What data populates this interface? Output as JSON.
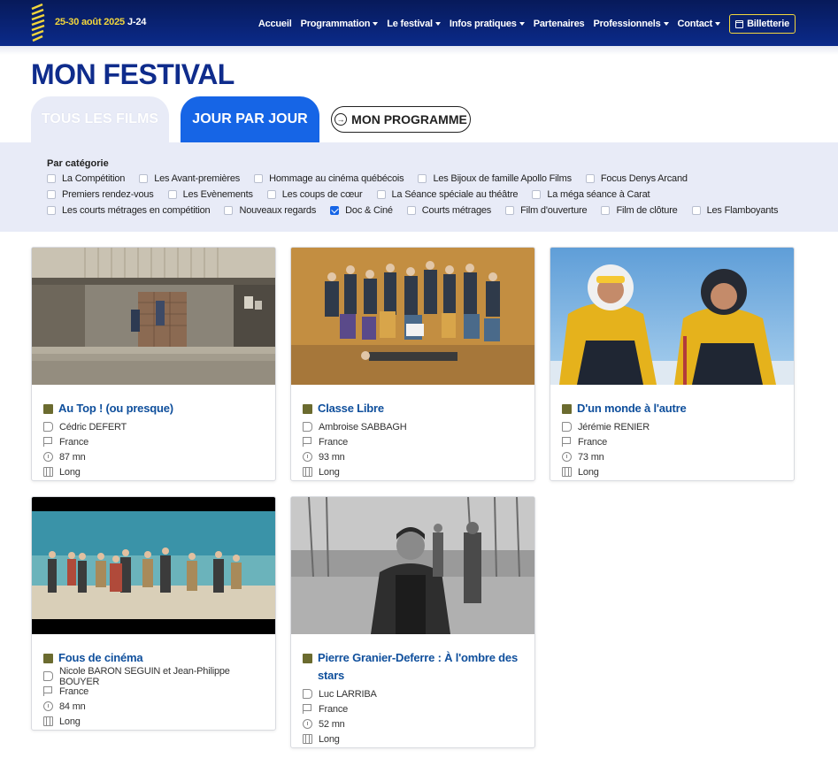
{
  "header": {
    "dates": "25-30 août 2025",
    "countdown": "J-24",
    "nav": [
      {
        "label": "Accueil",
        "dropdown": false
      },
      {
        "label": "Programmation",
        "dropdown": true
      },
      {
        "label": "Le festival",
        "dropdown": true
      },
      {
        "label": "Infos pratiques",
        "dropdown": true
      },
      {
        "label": "Partenaires",
        "dropdown": false
      },
      {
        "label": "Professionnels",
        "dropdown": true
      },
      {
        "label": "Contact",
        "dropdown": true
      }
    ],
    "ticket_label": "Billetterie"
  },
  "page_title": "MON FESTIVAL",
  "tabs": {
    "all": "TOUS LES FILMS",
    "day": "JOUR PAR JOUR",
    "program": "MON PROGRAMME"
  },
  "filters": {
    "title": "Par catégorie",
    "rows": [
      [
        {
          "label": "La Compétition",
          "checked": false
        },
        {
          "label": "Les Avant-premières",
          "checked": false
        },
        {
          "label": "Hommage au cinéma québécois",
          "checked": false
        },
        {
          "label": "Les Bijoux de famille Apollo Films",
          "checked": false
        },
        {
          "label": "Focus Denys Arcand",
          "checked": false
        }
      ],
      [
        {
          "label": "Premiers rendez-vous",
          "checked": false
        },
        {
          "label": "Les Evènements",
          "checked": false
        },
        {
          "label": "Les coups de cœur",
          "checked": false
        },
        {
          "label": "La Séance spéciale au théâtre",
          "checked": false
        },
        {
          "label": "La méga séance à Carat",
          "checked": false
        }
      ],
      [
        {
          "label": "Les courts métrages en compétition",
          "checked": false
        },
        {
          "label": "Nouveaux regards",
          "checked": false
        },
        {
          "label": "Doc & Ciné",
          "checked": true
        },
        {
          "label": "Courts métrages",
          "checked": false
        },
        {
          "label": "Film d'ouverture",
          "checked": false
        },
        {
          "label": "Film de clôture",
          "checked": false
        },
        {
          "label": "Les Flamboyants",
          "checked": false
        }
      ]
    ]
  },
  "films": [
    {
      "title": "Au Top ! (ou presque)",
      "director": "Cédric DEFERT",
      "country": "France",
      "duration": "87 mn",
      "format": "Long"
    },
    {
      "title": "Classe Libre",
      "director": "Ambroise SABBAGH",
      "country": "France",
      "duration": "93 mn",
      "format": "Long"
    },
    {
      "title": "D'un monde à l'autre",
      "director": "Jérémie RENIER",
      "country": "France",
      "duration": "73 mn",
      "format": "Long"
    },
    {
      "title": "Fous de cinéma",
      "director": "Nicole BARON SEGUIN et Jean-Philippe BOUYER",
      "country": "France",
      "duration": "84 mn",
      "format": "Long"
    },
    {
      "title": "Pierre Granier-Deferre : À l'ombre des stars",
      "director": "Luc LARRIBA",
      "country": "France",
      "duration": "52 mn",
      "format": "Long"
    }
  ],
  "colors": {
    "header_bg": "#0b2a8a",
    "accent_yellow": "#f2d63c",
    "title_blue": "#0f2c8c",
    "tab_active": "#1665e6",
    "filter_bg": "#e8ebf7",
    "link_blue": "#0f4f9c",
    "category_square": "#6b6b2f"
  }
}
